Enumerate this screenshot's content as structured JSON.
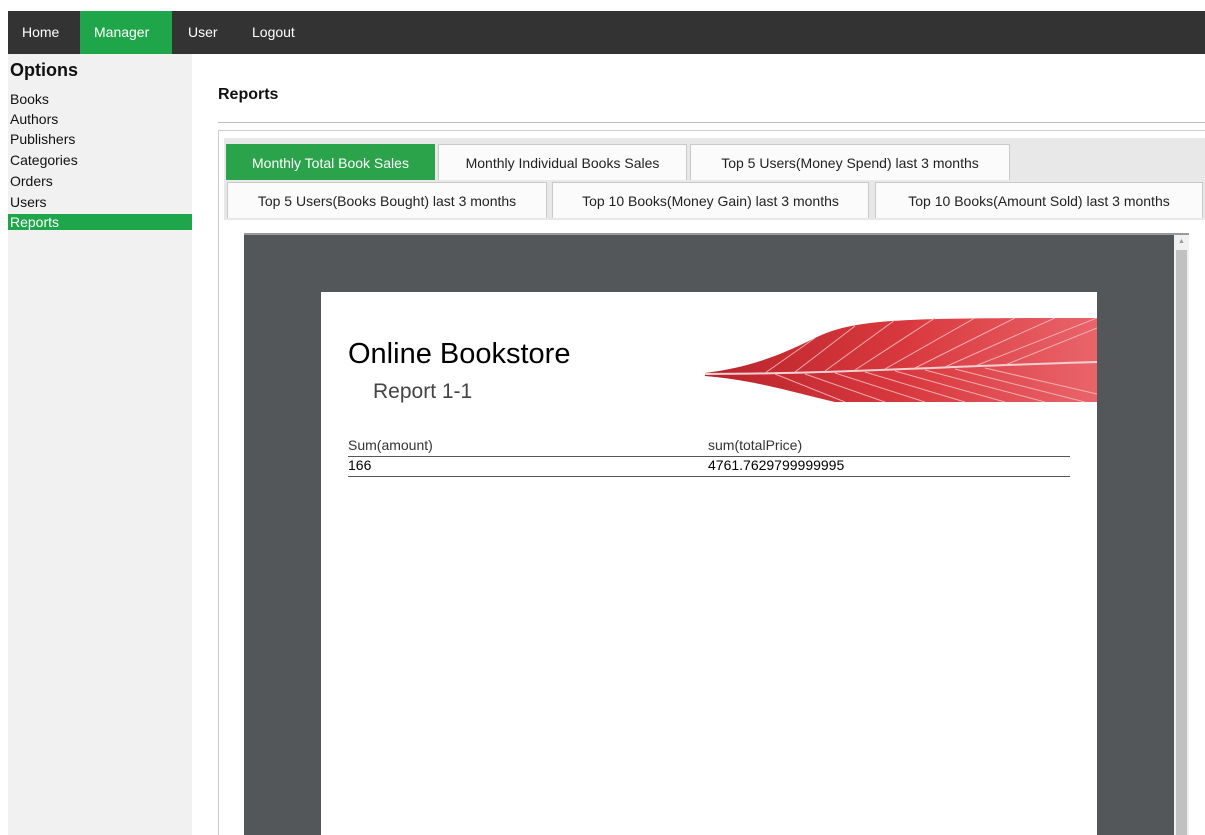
{
  "nav": {
    "items": [
      "Home",
      "Manager",
      "User",
      "Logout"
    ]
  },
  "sidebar": {
    "title": "Options",
    "items": [
      "Books",
      "Authors",
      "Publishers",
      "Categories",
      "Orders",
      "Users",
      "Reports"
    ]
  },
  "page": {
    "heading": "Reports"
  },
  "tabs": [
    "Monthly Total Book Sales",
    "Monthly Individual Books Sales",
    "Top 5 Users(Money Spend) last 3 months",
    "Top 5 Users(Books Bought) last 3 months",
    "Top 10 Books(Money Gain) last 3 months",
    "Top 10 Books(Amount Sold) last 3 months"
  ],
  "report": {
    "title": "Online Bookstore",
    "subtitle": "Report 1-1",
    "columns": [
      "Sum(amount)",
      "sum(totalPrice)"
    ],
    "row": [
      "166",
      "4761.7629799999995"
    ]
  },
  "colors": {
    "nav_bg": "#333333",
    "accent": "#1fa64a",
    "sidebar_bg": "#f1f1f1",
    "viewer_bg": "#53575a",
    "leaf": "#d8383d"
  }
}
